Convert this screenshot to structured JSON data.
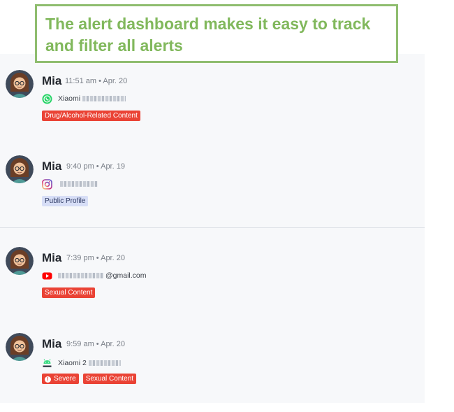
{
  "callout": {
    "text": "The alert dashboard makes it easy to track and filter all alerts"
  },
  "colors": {
    "callout_border": "#8fbd6f",
    "callout_text": "#81b85c",
    "tag_red": "#ea4335",
    "tag_blue": "#d7def6"
  },
  "alerts": [
    {
      "name": "Mia",
      "time": "11:51 am • Apr. 20",
      "app_icon": "whatsapp-icon",
      "source": "Xiaomi",
      "tags": [
        "Drug/Alcohol-Related Content"
      ]
    },
    {
      "name": "Mia",
      "time": "9:40 pm • Apr. 19",
      "app_icon": "instagram-icon",
      "source": "",
      "tags": [
        "Public Profile"
      ]
    },
    {
      "name": "Mia",
      "time": "7:39 pm • Apr. 20",
      "app_icon": "youtube-icon",
      "source": "@gmail.com",
      "tags": [
        "Sexual Content"
      ]
    },
    {
      "name": "Mia",
      "time": "9:59 am • Apr. 20",
      "app_icon": "android-icon",
      "source": "Xiaomi 2",
      "tags": [
        "Severe",
        "Sexual Content"
      ]
    }
  ]
}
